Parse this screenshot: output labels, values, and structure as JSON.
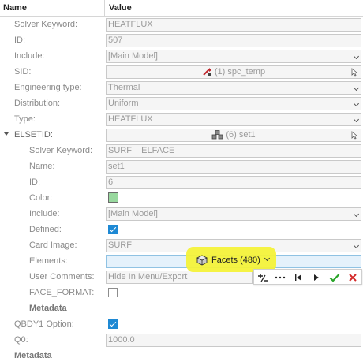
{
  "header": {
    "name_label": "Name",
    "value_label": "Value"
  },
  "rows": {
    "solver_keyword": {
      "label": "Solver Keyword:",
      "value": "HEATFLUX"
    },
    "id": {
      "label": "ID:",
      "value": "507"
    },
    "include": {
      "label": "Include:",
      "value": "[Main Model]"
    },
    "sid": {
      "label": "SID:",
      "value": "(1) spc_temp",
      "icon": "load-collector-icon"
    },
    "engineering_type": {
      "label": "Engineering type:",
      "value": "Thermal"
    },
    "distribution": {
      "label": "Distribution:",
      "value": "Uniform"
    },
    "type": {
      "label": "Type:",
      "value": "HEATFLUX"
    },
    "elsetid": {
      "label": "ELSETID:",
      "value": "(6) set1",
      "icon": "set-icon"
    },
    "set_solver_keyword": {
      "label": "Solver Keyword:",
      "value": "SURF    ELFACE"
    },
    "set_name": {
      "label": "Name:",
      "value": "set1"
    },
    "set_id": {
      "label": "ID:",
      "value": "6"
    },
    "set_color": {
      "label": "Color:",
      "value": "#98d89e"
    },
    "set_include": {
      "label": "Include:",
      "value": "[Main Model]"
    },
    "set_defined": {
      "label": "Defined:",
      "checked": true
    },
    "set_card_image": {
      "label": "Card Image:",
      "value": "SURF"
    },
    "set_elements": {
      "label": "Elements:",
      "value": "Facets (480)"
    },
    "set_user_comments": {
      "label": "User Comments:",
      "value": "Hide In Menu/Export"
    },
    "set_face_format": {
      "label": "FACE_FORMAT:",
      "checked": false
    },
    "set_metadata": {
      "label": "Metadata"
    },
    "qbdy1_option": {
      "label": "QBDY1 Option:",
      "checked": true
    },
    "q0": {
      "label": "Q0:",
      "value": "1000.0"
    },
    "metadata": {
      "label": "Metadata"
    }
  },
  "toolbar": {
    "buttons": [
      "add-remove-icon",
      "more-icon",
      "first-icon",
      "next-icon",
      "accept-icon",
      "reject-icon"
    ]
  },
  "colors": {
    "highlight": "#f4f23a",
    "accent": "#1e89d4",
    "accept": "#2aa52a",
    "reject": "#d42a2a"
  }
}
